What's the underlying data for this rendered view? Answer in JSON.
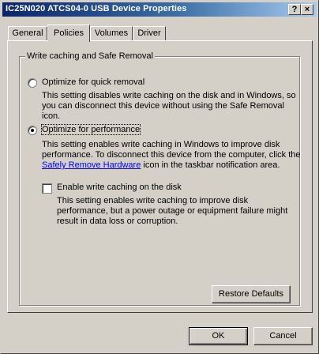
{
  "window": {
    "title": "IC25N020 ATCS04-0 USB Device Properties",
    "help_button": "?",
    "close_button": "×"
  },
  "tabs": [
    {
      "label": "General",
      "active": false
    },
    {
      "label": "Policies",
      "active": true
    },
    {
      "label": "Volumes",
      "active": false
    },
    {
      "label": "Driver",
      "active": false
    }
  ],
  "group": {
    "legend": "Write caching and Safe Removal"
  },
  "options": {
    "quick_removal": {
      "label": "Optimize for quick removal",
      "selected": false,
      "description": "This setting disables write caching on the disk and in Windows, so you can disconnect this device without using the Safe Removal icon."
    },
    "performance": {
      "label": "Optimize for performance",
      "selected": true,
      "description_before": "This setting enables write caching in Windows to improve disk performance. To disconnect this device from the computer, click the ",
      "link": "Safely Remove Hardware",
      "description_after": " icon in the taskbar notification area."
    },
    "write_caching": {
      "label": "Enable write caching on the disk",
      "checked": false,
      "description": "This setting enables write caching to improve disk performance, but a power outage or equipment failure might result in data loss or corruption."
    }
  },
  "buttons": {
    "restore_defaults": "Restore Defaults",
    "ok": "OK",
    "cancel": "Cancel"
  }
}
